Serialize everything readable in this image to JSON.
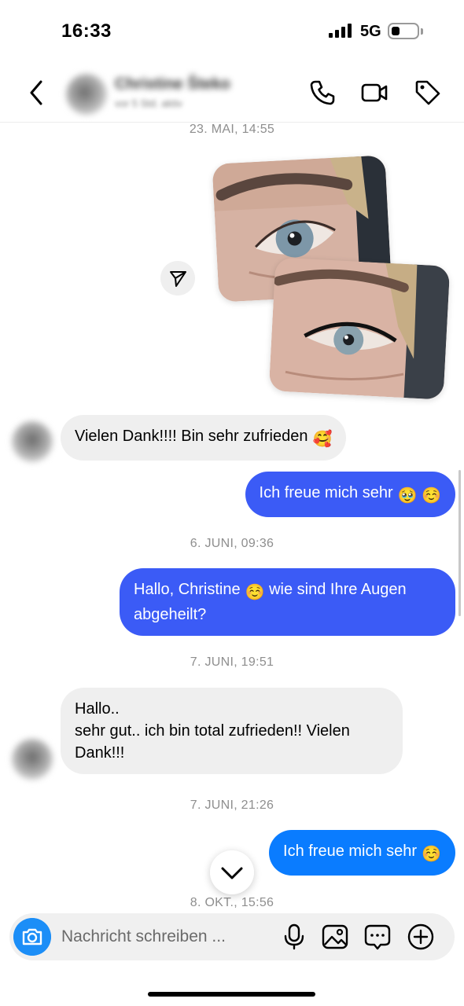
{
  "status_bar": {
    "time": "16:33",
    "network": "5G",
    "battery_level": 0.25
  },
  "header": {
    "contact_name": "Christine Šteko",
    "contact_sub": "vor 5 Std. aktiv"
  },
  "icons": {
    "back": "chevron-left-icon",
    "call": "phone-icon",
    "video": "video-camera-icon",
    "tag": "tag-icon",
    "share": "send-icon",
    "scroll_down": "chevron-down-icon",
    "camera": "camera-icon",
    "mic": "microphone-icon",
    "gallery": "image-icon",
    "sticker": "message-dots-icon",
    "add": "plus-circle-icon"
  },
  "conversation": {
    "ts1": "23. MAI, 14:55",
    "msg1": "Vielen Dank!!!! Bin sehr zufrieden",
    "msg1_emoji": "🥰",
    "msg2": "Ich freue mich sehr",
    "msg2_emoji": "🥹 ☺️",
    "ts2": "6. JUNI, 09:36",
    "msg3_a": "Hallo, Christine",
    "msg3_emoji": "☺️",
    "msg3_b": "wie sind Ihre Augen abgeheilt?",
    "ts3": "7. JUNI, 19:51",
    "msg4_line1": "Hallo..",
    "msg4_line2": "sehr gut.. ich bin total zufrieden!! Vielen Dank!!!",
    "ts4": "7. JUNI, 21:26",
    "msg5": "Ich freue mich sehr",
    "msg5_emoji": "☺️",
    "ts5": "8. OKT., 15:56"
  },
  "composer": {
    "placeholder": "Nachricht schreiben ..."
  },
  "colors": {
    "outgoing_bubble": "#3b5bf6",
    "outgoing_bubble_latest": "#0a7cff",
    "incoming_bubble": "#efefef",
    "camera_button": "#1c8ef7"
  }
}
